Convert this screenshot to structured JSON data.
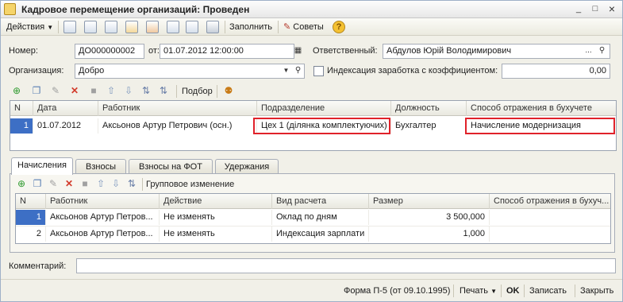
{
  "window": {
    "title": "Кадровое перемещение организаций: Проведен",
    "controls": {
      "minimize": "_",
      "maximize": "□",
      "close": "×"
    }
  },
  "toolbar": {
    "actions_label": "Действия",
    "fill_label": "Заполнить",
    "tips_label": "Советы",
    "help_glyph": "?"
  },
  "header": {
    "number_label": "Номер:",
    "number_value": "ДО000000002",
    "date_label": "от:",
    "date_value": "01.07.2012 12:00:00",
    "responsible_label": "Ответственный:",
    "responsible_value": "Абдулов Юрій Володимирович",
    "organization_label": "Организация:",
    "organization_value": "Добро",
    "indexation_label": "Индексация заработка с коэффициентом:",
    "indexation_value": "0,00",
    "ellipsis": "...",
    "search_glyph": "🔍"
  },
  "employees_toolbar": {
    "select_label": "Подбор"
  },
  "employees_table": {
    "columns": [
      "N",
      "Дата",
      "Работник",
      "Подразделение",
      "Должность",
      "Способ отражения в бухучете"
    ],
    "rows": [
      {
        "n": "1",
        "date": "01.07.2012",
        "employee": "Аксьонов Артур Петрович (осн.)",
        "department": "Цех 1 (ділянка комплектуючих)",
        "position": "Бухгалтер",
        "reflection": "Начисление модернизация"
      }
    ]
  },
  "tabs": [
    "Начисления",
    "Взносы",
    "Взносы на ФОТ",
    "Удержания"
  ],
  "accruals_toolbar": {
    "group_change_label": "Групповое изменение"
  },
  "accruals_table": {
    "columns": [
      "N",
      "Работник",
      "Действие",
      "Вид расчета",
      "Размер",
      "Способ отражения в бухуч..."
    ],
    "rows": [
      {
        "n": "1",
        "employee": "Аксьонов Артур Петров...",
        "action": "Не изменять",
        "calc_type": "Оклад по дням",
        "size": "3 500,000",
        "reflection": ""
      },
      {
        "n": "2",
        "employee": "Аксьонов Артур Петров...",
        "action": "Не изменять",
        "calc_type": "Индексация зарплати",
        "size": "1,000",
        "reflection": ""
      }
    ]
  },
  "comment": {
    "label": "Комментарий:",
    "value": ""
  },
  "footer": {
    "form_label": "Форма П-5 (от 09.10.1995)",
    "print_label": "Печать",
    "ok_label": "OK",
    "save_label": "Записать",
    "close_label": "Закрыть"
  },
  "colors": {
    "highlight": "#e0222a",
    "selection": "#3d6fc5"
  }
}
